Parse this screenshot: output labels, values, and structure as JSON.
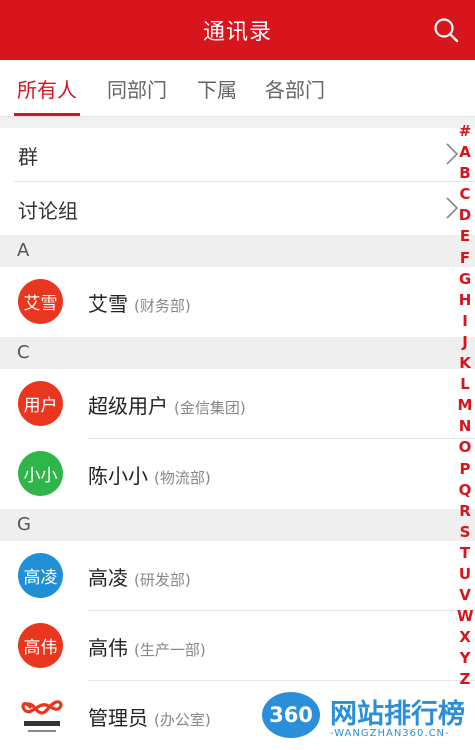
{
  "header": {
    "title": "通讯录",
    "search_icon": "search-icon"
  },
  "tabs": [
    {
      "label": "所有人",
      "active": true
    },
    {
      "label": "同部门",
      "active": false
    },
    {
      "label": "下属",
      "active": false
    },
    {
      "label": "各部门",
      "active": false
    }
  ],
  "groups": [
    {
      "label": "群"
    },
    {
      "label": "讨论组"
    }
  ],
  "sections": [
    {
      "letter": "A",
      "contacts": [
        {
          "avatar_text": "艾雪",
          "avatar_color": "#e8361f",
          "name": "艾雪",
          "dept": "(财务部)"
        }
      ]
    },
    {
      "letter": "C",
      "contacts": [
        {
          "avatar_text": "用户",
          "avatar_color": "#e8361f",
          "name": "超级用户",
          "dept": "(金信集团)"
        },
        {
          "avatar_text": "小小",
          "avatar_color": "#2fb54a",
          "name": "陈小小",
          "dept": "(物流部)"
        }
      ]
    },
    {
      "letter": "G",
      "contacts": [
        {
          "avatar_text": "高凌",
          "avatar_color": "#1f8fd6",
          "name": "高凌",
          "dept": "(研发部)"
        },
        {
          "avatar_text": "高伟",
          "avatar_color": "#e8361f",
          "name": "高伟",
          "dept": "(生产一部)"
        },
        {
          "avatar_text": "华天动力",
          "avatar_icon": "company-logo-icon",
          "name": "管理员",
          "dept": "(办公室)"
        }
      ]
    }
  ],
  "index_letters": [
    "#",
    "A",
    "B",
    "C",
    "D",
    "E",
    "F",
    "G",
    "H",
    "I",
    "J",
    "K",
    "L",
    "M",
    "N",
    "O",
    "P",
    "Q",
    "R",
    "S",
    "T",
    "U",
    "V",
    "W",
    "X",
    "Y",
    "Z"
  ],
  "watermark": {
    "badge": "360",
    "title": "网站排行榜",
    "subtitle": "-WANGZHAN360.CN-"
  },
  "colors": {
    "accent": "#d8141d",
    "index": "#d8141d"
  }
}
